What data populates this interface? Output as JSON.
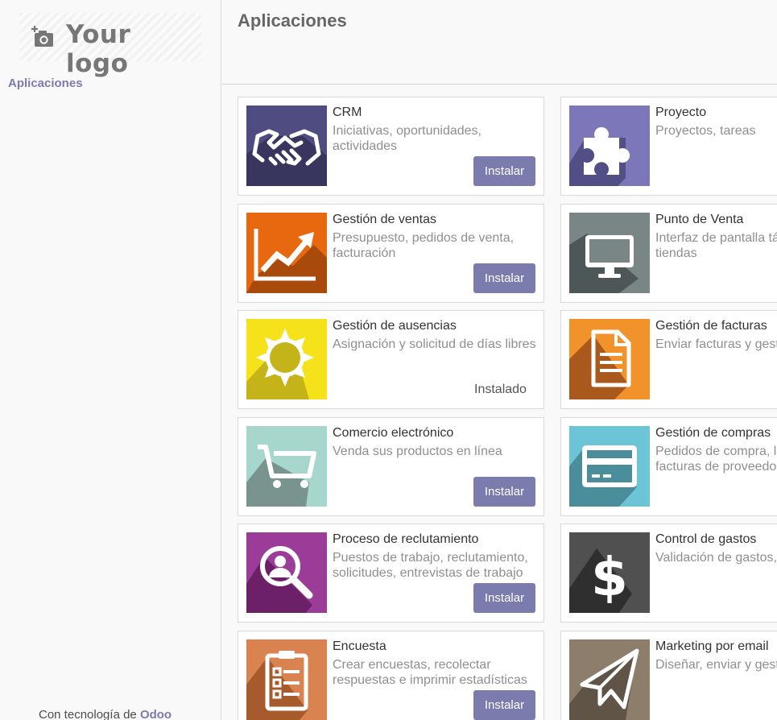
{
  "logo": {
    "text": "Your logo",
    "icon": "camera-add-icon"
  },
  "sidebar": {
    "menu_item": "Aplicaciones"
  },
  "footer": {
    "prefix": "Con tecnología de ",
    "brand": "Odoo"
  },
  "header": {
    "title": "Aplicaciones"
  },
  "apps": [
    {
      "name": "CRM",
      "summary": "Iniciativas, oportunidades, actividades",
      "action": "Instalar",
      "icon": "handshake-icon",
      "color": "#4f4c82"
    },
    {
      "name": "Proyecto",
      "summary": "Proyectos, tareas",
      "action": "",
      "icon": "puzzle-icon",
      "color": "#7b77b8"
    },
    {
      "name": "Gestión de ventas",
      "summary": "Presupuesto, pedidos de venta, facturación",
      "action": "Instalar",
      "icon": "trend-chart-icon",
      "color": "#e8680f"
    },
    {
      "name": "Punto de Venta",
      "summary": "Interfaz de pantalla táctil para tiendas",
      "action": "",
      "icon": "monitor-icon",
      "color": "#7a8686"
    },
    {
      "name": "Gestión de ausencias",
      "summary": "Asignación y solicitud de días libres",
      "action": "",
      "status": "Instalado",
      "icon": "sun-icon",
      "color": "#f5e21a"
    },
    {
      "name": "Gestión de facturas",
      "summary": "Enviar facturas y gestionar pagos",
      "action": "",
      "icon": "document-icon",
      "color": "#f2922a"
    },
    {
      "name": "Comercio electrónico",
      "summary": "Venda sus productos en línea",
      "action": "Instalar",
      "icon": "cart-icon",
      "color": "#a7d6cd"
    },
    {
      "name": "Gestión de compras",
      "summary": "Pedidos de compra, licitaciones y facturas de proveedores",
      "action": "",
      "icon": "credit-card-icon",
      "color": "#6cc5d6"
    },
    {
      "name": "Proceso de reclutamiento",
      "summary": "Puestos de trabajo, reclutamiento, solicitudes, entrevistas de trabajo",
      "action": "Instalar",
      "icon": "search-person-icon",
      "color": "#9b3c98"
    },
    {
      "name": "Control de gastos",
      "summary": "Validación de gastos, reembolsos",
      "action": "",
      "icon": "dollar-icon",
      "color": "#505050"
    },
    {
      "name": "Encuesta",
      "summary": "Crear encuestas, recolectar respuestas e imprimir estadísticas",
      "action": "Instalar",
      "icon": "clipboard-icon",
      "color": "#d98450"
    },
    {
      "name": "Marketing por email",
      "summary": "Diseñar, enviar y gestionar correos electrónicos",
      "action": "",
      "icon": "paper-plane-icon",
      "color": "#8d7e6b"
    }
  ]
}
